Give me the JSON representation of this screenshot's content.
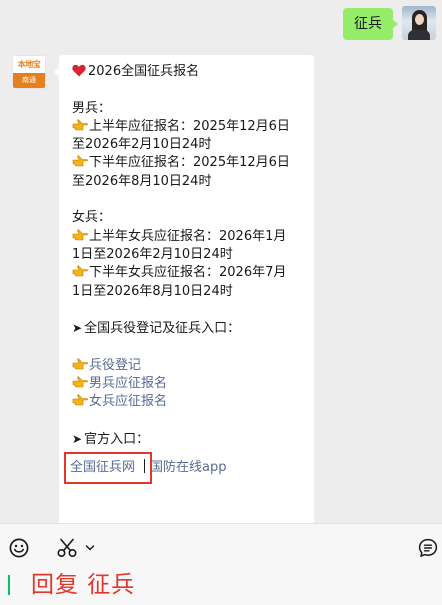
{
  "outgoing_message": {
    "text": "征兵"
  },
  "incoming_message": {
    "title": "2026全国征兵报名",
    "male": {
      "heading": "男兵：",
      "line1a": "上半年应征报名：2025年12月6日",
      "line1b": "至2026年2月10日24时",
      "line2a": "下半年应征报名：2025年12月6日",
      "line2b": "至2026年8月10日24时"
    },
    "female": {
      "heading": "女兵：",
      "line1a": "上半年女兵应征报名：2026年1月",
      "line1b": "1日至2026年2月10日24时",
      "line2a": "下半年女兵应征报名：2026年7月",
      "line2b": "1日至2026年8月10日24时"
    },
    "entry_heading": "全国兵役登记及征兵入口：",
    "entry_links": [
      "兵役登记",
      "男兵应征报名",
      "女兵应征报名"
    ],
    "official_heading": "官方入口：",
    "official_links": [
      "全国征兵网",
      "国防在线app"
    ]
  },
  "bot_avatar": {
    "logo_top": "本地宝",
    "logo_bottom": "南通"
  },
  "input": {
    "text": "回复 征兵"
  },
  "icons": {
    "emoji": "smiley-icon",
    "scissors": "scissors-icon",
    "chevron": "chevron-down-icon",
    "history": "chat-history-icon"
  },
  "colors": {
    "outgoing_bubble": "#95ec69",
    "link": "#576b95",
    "highlight_box": "#e2352c",
    "reply_text": "#e2352c",
    "caret": "#07c160",
    "hand_icon": "#f5b316"
  }
}
